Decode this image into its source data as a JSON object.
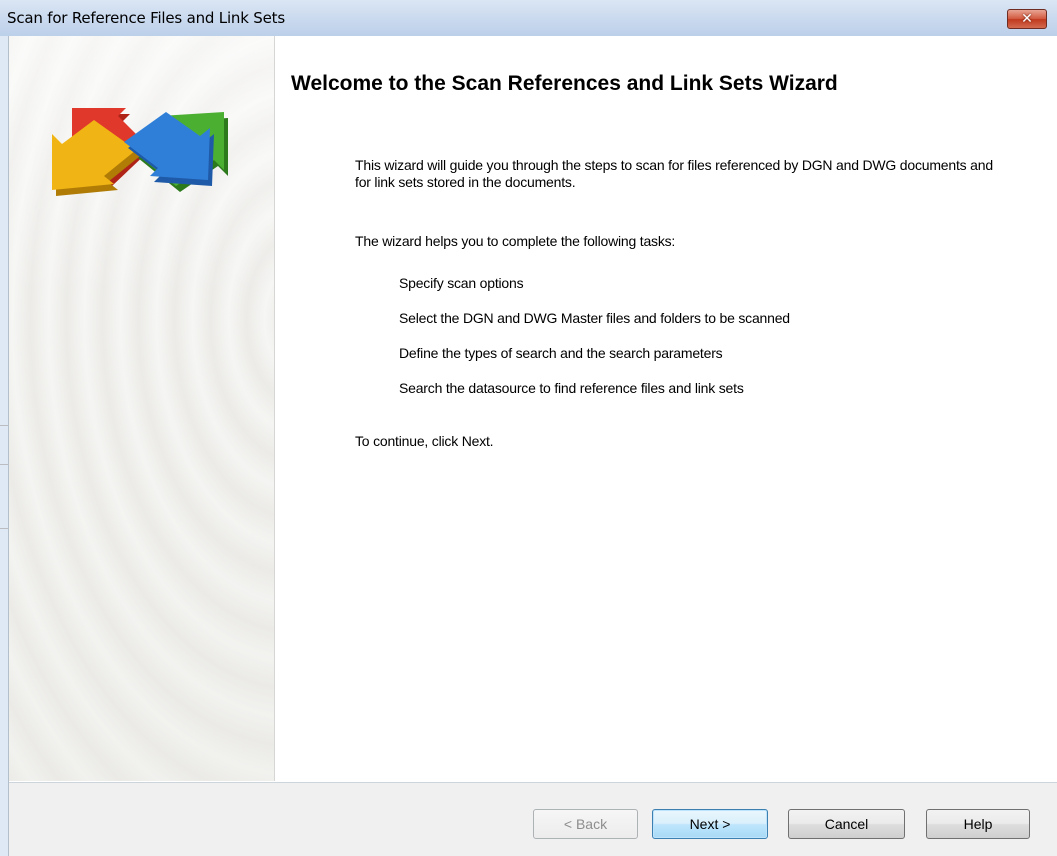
{
  "window": {
    "title": "Scan for Reference Files and Link Sets",
    "close_glyph": "✕"
  },
  "wizard": {
    "heading": "Welcome to the Scan References and Link Sets Wizard",
    "intro": "This wizard will guide you through the steps to scan for files referenced by DGN and DWG documents and for link sets stored in the documents.",
    "tasks_intro": "The wizard helps you to complete the following tasks:",
    "tasks": [
      "Specify scan options",
      "Select the DGN and DWG Master files and folders to be scanned",
      "Define the types of search and the search parameters",
      "Search the datasource to find reference files and link sets"
    ],
    "continue_text": "To continue, click Next."
  },
  "buttons": {
    "back": "< Back",
    "next": "Next >",
    "cancel": "Cancel",
    "help": "Help"
  },
  "icons": {
    "logo": "four-way-arrows-icon",
    "close": "close-icon"
  },
  "colors": {
    "arrow_red": "#e0382a",
    "arrow_green": "#4bb032",
    "arrow_yellow": "#f0b414",
    "arrow_blue": "#2f7fd8",
    "close_button": "#c7432a"
  }
}
